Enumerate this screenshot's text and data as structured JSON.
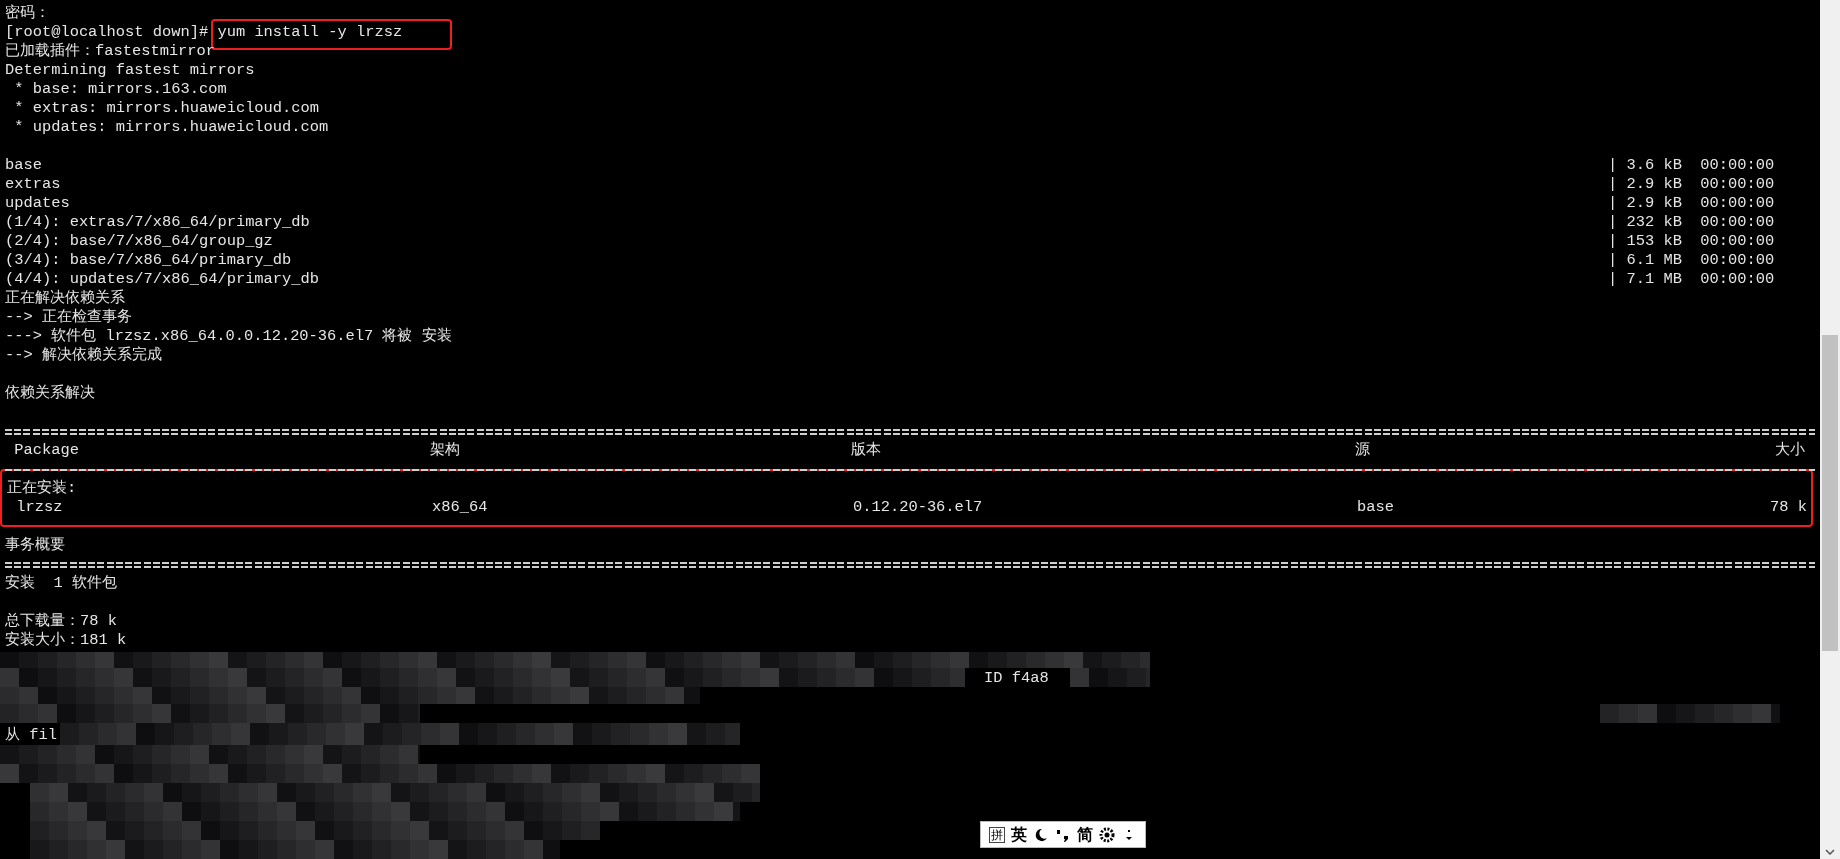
{
  "terminal": {
    "lines": [
      {
        "kind": "text",
        "text": "密码："
      },
      {
        "kind": "prompt",
        "prompt": "[root@localhost down]# ",
        "command": "yum install -y lrzsz",
        "highlighted": true
      },
      {
        "kind": "text",
        "text": "已加载插件：fastestmirror"
      },
      {
        "kind": "text",
        "text": "Determining fastest mirrors"
      },
      {
        "kind": "text",
        "text": " * base: mirrors.163.com"
      },
      {
        "kind": "text",
        "text": " * extras: mirrors.huaweicloud.com"
      },
      {
        "kind": "text",
        "text": " * updates: mirrors.huaweicloud.com"
      },
      {
        "kind": "blank"
      },
      {
        "kind": "progress",
        "name": "base",
        "stat": "| 3.6 kB  00:00:00"
      },
      {
        "kind": "progress",
        "name": "extras",
        "stat": "| 2.9 kB  00:00:00"
      },
      {
        "kind": "progress",
        "name": "updates",
        "stat": "| 2.9 kB  00:00:00"
      },
      {
        "kind": "progress",
        "name": "(1/4): extras/7/x86_64/primary_db",
        "stat": "| 232 kB  00:00:00"
      },
      {
        "kind": "progress",
        "name": "(2/4): base/7/x86_64/group_gz",
        "stat": "| 153 kB  00:00:00"
      },
      {
        "kind": "progress",
        "name": "(3/4): base/7/x86_64/primary_db",
        "stat": "| 6.1 MB  00:00:00"
      },
      {
        "kind": "progress",
        "name": "(4/4): updates/7/x86_64/primary_db",
        "stat": "| 7.1 MB  00:00:00"
      },
      {
        "kind": "text",
        "text": "正在解决依赖关系"
      },
      {
        "kind": "text",
        "text": "--> 正在检查事务"
      },
      {
        "kind": "text",
        "text": "---> 软件包 lrzsz.x86_64.0.0.12.20-36.el7 将被 安装"
      },
      {
        "kind": "text",
        "text": "--> 解决依赖关系完成"
      },
      {
        "kind": "blank"
      },
      {
        "kind": "text",
        "text": "依赖关系解决"
      },
      {
        "kind": "blank"
      },
      {
        "kind": "rule_double"
      },
      {
        "kind": "table_row",
        "cells": [
          " Package",
          "架构",
          "版本",
          "源",
          "大小"
        ]
      },
      {
        "kind": "rule_single"
      },
      {
        "kind": "group",
        "highlighted": true,
        "lines": [
          {
            "kind": "text",
            "text": "正在安装:"
          },
          {
            "kind": "table_row",
            "cells": [
              " lrzsz",
              "x86_64",
              "0.12.20-36.el7",
              "base",
              "78 k"
            ]
          }
        ]
      },
      {
        "kind": "blank"
      },
      {
        "kind": "text",
        "text": "事务概要"
      },
      {
        "kind": "rule_double"
      },
      {
        "kind": "text",
        "text": "安装  1 软件包"
      },
      {
        "kind": "blank"
      },
      {
        "kind": "text",
        "text": "总下载量：78 k"
      },
      {
        "kind": "text",
        "text": "安装大小：181 k"
      },
      {
        "kind": "blank"
      },
      {
        "kind": "partial",
        "text": "ID f4a8"
      },
      {
        "kind": "blank"
      },
      {
        "kind": "blank"
      },
      {
        "kind": "partial",
        "text": "从 fil"
      }
    ]
  },
  "ime_toolbar": {
    "mode": "拼",
    "language": "英",
    "script": "简"
  }
}
